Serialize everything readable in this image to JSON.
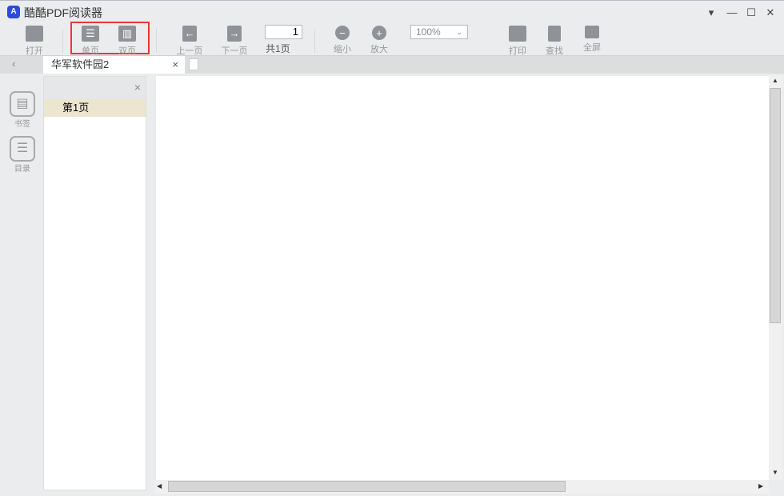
{
  "app": {
    "title": "酷酷PDF阅读器",
    "logo": "A"
  },
  "window_controls": {
    "menu": "▾",
    "minimize": "—",
    "maximize": "☐",
    "close": "✕"
  },
  "toolbar": {
    "open": "打开",
    "single_page": "单页",
    "double_page": "双页",
    "prev_page": "上一页",
    "next_page": "下一页",
    "page_input": "1",
    "page_total": "共1页",
    "zoom_out": "缩小",
    "zoom_in": "放大",
    "zoom_value": "100%",
    "print": "打印",
    "find": "查找",
    "fullscreen": "全屏"
  },
  "tabs": [
    {
      "label": "华军软件园2",
      "close": "×"
    }
  ],
  "sidebar": {
    "bookmark": "书签",
    "toc": "目录"
  },
  "panel": {
    "close": "×",
    "items": [
      "第1页"
    ]
  },
  "highlight_color": "#e53935"
}
